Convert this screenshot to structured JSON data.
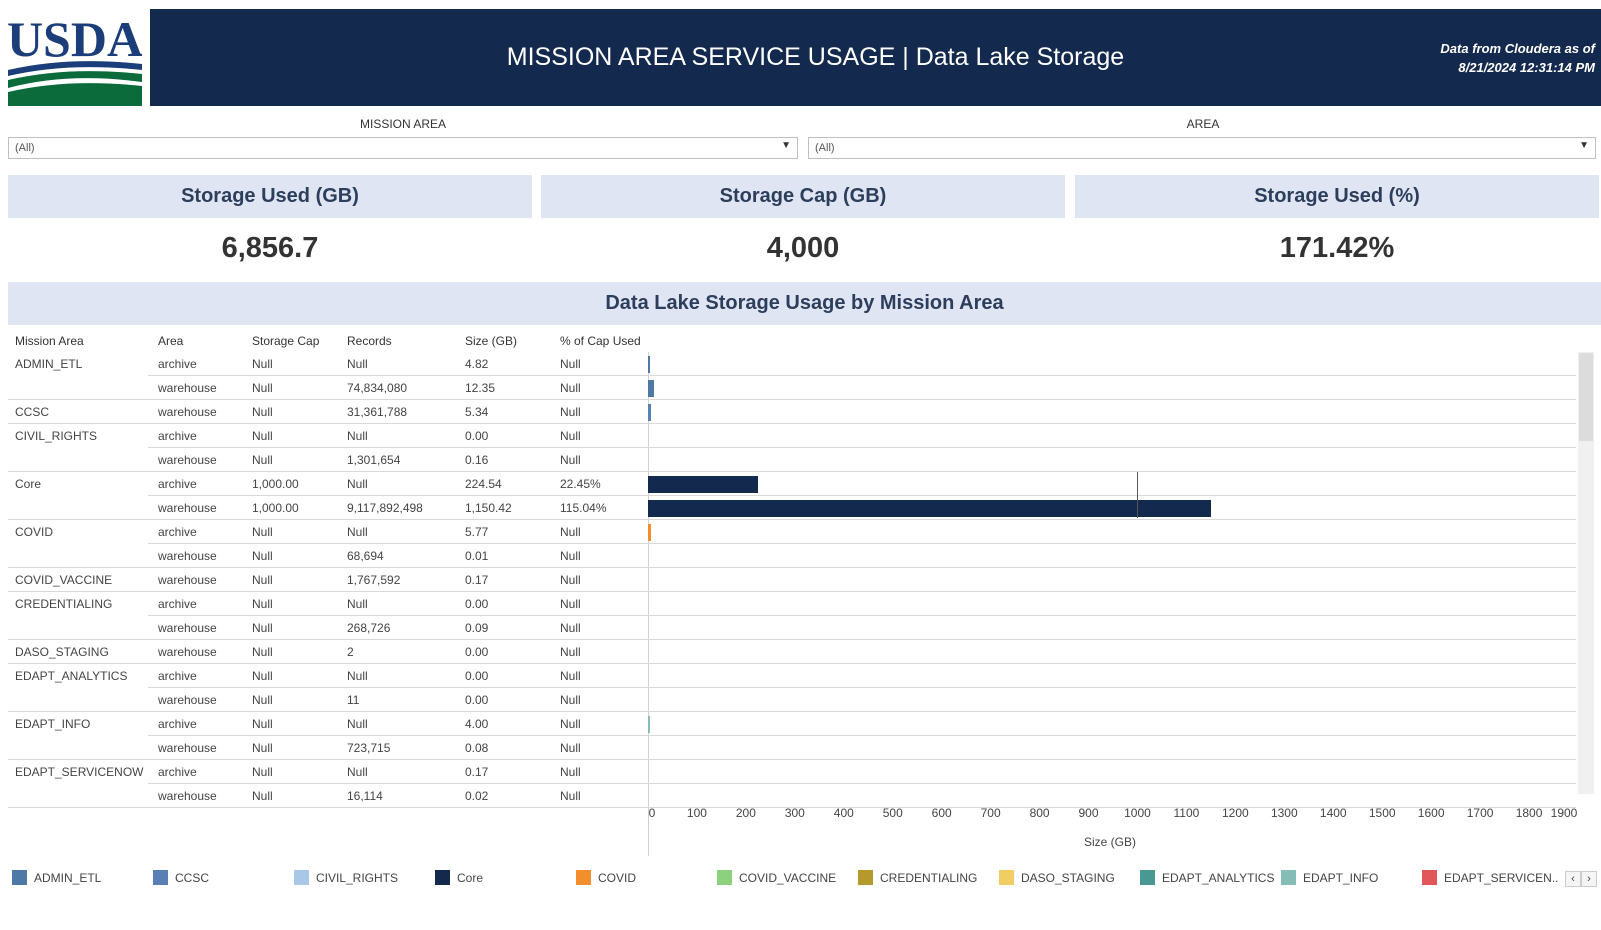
{
  "header": {
    "logo_text": "USDA",
    "title": "MISSION AREA SERVICE USAGE | Data Lake Storage",
    "note_line1": "Data from Cloudera as of",
    "note_line2": "8/21/2024 12:31:14 PM"
  },
  "filters": {
    "mission_area": {
      "label": "MISSION AREA",
      "value": "(All)"
    },
    "area": {
      "label": "AREA",
      "value": "(All)"
    }
  },
  "kpis": [
    {
      "label": "Storage Used (GB)",
      "value": "6,856.7"
    },
    {
      "label": "Storage Cap (GB)",
      "value": "4,000"
    },
    {
      "label": "Storage Used (%)",
      "value": "171.42%"
    }
  ],
  "table": {
    "title": "Data Lake Storage Usage by Mission Area",
    "columns": [
      "Mission Area",
      "Area",
      "Storage Cap",
      "Records",
      "Size (GB)",
      "% of Cap Used"
    ],
    "rows": [
      {
        "mission": "ADMIN_ETL",
        "area": "archive",
        "cap": "Null",
        "records": "Null",
        "size": "4.82",
        "pct": "Null"
      },
      {
        "mission": "",
        "area": "warehouse",
        "cap": "Null",
        "records": "74,834,080",
        "size": "12.35",
        "pct": "Null"
      },
      {
        "mission": "CCSC",
        "area": "warehouse",
        "cap": "Null",
        "records": "31,361,788",
        "size": "5.34",
        "pct": "Null"
      },
      {
        "mission": "CIVIL_RIGHTS",
        "area": "archive",
        "cap": "Null",
        "records": "Null",
        "size": "0.00",
        "pct": "Null"
      },
      {
        "mission": "",
        "area": "warehouse",
        "cap": "Null",
        "records": "1,301,654",
        "size": "0.16",
        "pct": "Null"
      },
      {
        "mission": "Core",
        "area": "archive",
        "cap": "1,000.00",
        "records": "Null",
        "size": "224.54",
        "pct": "22.45%"
      },
      {
        "mission": "",
        "area": "warehouse",
        "cap": "1,000.00",
        "records": "9,117,892,498",
        "size": "1,150.42",
        "pct": "115.04%"
      },
      {
        "mission": "COVID",
        "area": "archive",
        "cap": "Null",
        "records": "Null",
        "size": "5.77",
        "pct": "Null"
      },
      {
        "mission": "",
        "area": "warehouse",
        "cap": "Null",
        "records": "68,694",
        "size": "0.01",
        "pct": "Null"
      },
      {
        "mission": "COVID_VACCINE",
        "area": "warehouse",
        "cap": "Null",
        "records": "1,767,592",
        "size": "0.17",
        "pct": "Null"
      },
      {
        "mission": "CREDENTIALING",
        "area": "archive",
        "cap": "Null",
        "records": "Null",
        "size": "0.00",
        "pct": "Null"
      },
      {
        "mission": "",
        "area": "warehouse",
        "cap": "Null",
        "records": "268,726",
        "size": "0.09",
        "pct": "Null"
      },
      {
        "mission": "DASO_STAGING",
        "area": "warehouse",
        "cap": "Null",
        "records": "2",
        "size": "0.00",
        "pct": "Null"
      },
      {
        "mission": "EDAPT_ANALYTICS",
        "area": "archive",
        "cap": "Null",
        "records": "Null",
        "size": "0.00",
        "pct": "Null"
      },
      {
        "mission": "",
        "area": "warehouse",
        "cap": "Null",
        "records": "11",
        "size": "0.00",
        "pct": "Null"
      },
      {
        "mission": "EDAPT_INFO",
        "area": "archive",
        "cap": "Null",
        "records": "Null",
        "size": "4.00",
        "pct": "Null"
      },
      {
        "mission": "",
        "area": "warehouse",
        "cap": "Null",
        "records": "723,715",
        "size": "0.08",
        "pct": "Null"
      },
      {
        "mission": "EDAPT_SERVICENOW",
        "area": "archive",
        "cap": "Null",
        "records": "Null",
        "size": "0.17",
        "pct": "Null"
      },
      {
        "mission": "",
        "area": "warehouse",
        "cap": "Null",
        "records": "16,114",
        "size": "0.02",
        "pct": "Null"
      }
    ]
  },
  "chart_data": {
    "type": "bar",
    "orientation": "horizontal",
    "xlabel": "Size (GB)",
    "xlim": [
      0,
      1900
    ],
    "ticks": [
      "0",
      "100",
      "200",
      "300",
      "400",
      "500",
      "600",
      "700",
      "800",
      "900",
      "1000",
      "1100",
      "1200",
      "1300",
      "1400",
      "1500",
      "1600",
      "1700",
      "1800",
      "1900"
    ],
    "reference_line": 1000,
    "values": [
      4.82,
      12.35,
      5.34,
      0.0,
      0.16,
      224.54,
      1150.42,
      5.77,
      0.01,
      0.17,
      0.0,
      0.09,
      0.0,
      0.0,
      0.0,
      4.0,
      0.08,
      0.17,
      0.02
    ],
    "series_of_row": [
      "ADMIN_ETL",
      "ADMIN_ETL",
      "CCSC",
      "CIVIL_RIGHTS",
      "CIVIL_RIGHTS",
      "Core",
      "Core",
      "COVID",
      "COVID",
      "COVID_VACCINE",
      "CREDENTIALING",
      "CREDENTIALING",
      "DASO_STAGING",
      "EDAPT_ANALYTICS",
      "EDAPT_ANALYTICS",
      "EDAPT_INFO",
      "EDAPT_INFO",
      "EDAPT_SERVICENOW",
      "EDAPT_SERVICENOW"
    ],
    "legend": [
      {
        "name": "ADMIN_ETL",
        "color": "#4e79a7"
      },
      {
        "name": "CCSC",
        "color": "#5a7fb5"
      },
      {
        "name": "CIVIL_RIGHTS",
        "color": "#a9c8e8"
      },
      {
        "name": "Core",
        "color": "#132a4e"
      },
      {
        "name": "COVID",
        "color": "#f28e2b"
      },
      {
        "name": "COVID_VACCINE",
        "color": "#8cd17d"
      },
      {
        "name": "CREDENTIALING",
        "color": "#b6992d"
      },
      {
        "name": "DASO_STAGING",
        "color": "#f1ce63"
      },
      {
        "name": "EDAPT_ANALYTICS",
        "color": "#499894"
      },
      {
        "name": "EDAPT_INFO",
        "color": "#86bcb6"
      },
      {
        "name": "EDAPT_SERVICEN..",
        "color": "#e15759"
      }
    ]
  },
  "legend_nav": {
    "prev": "‹",
    "next": "›"
  }
}
